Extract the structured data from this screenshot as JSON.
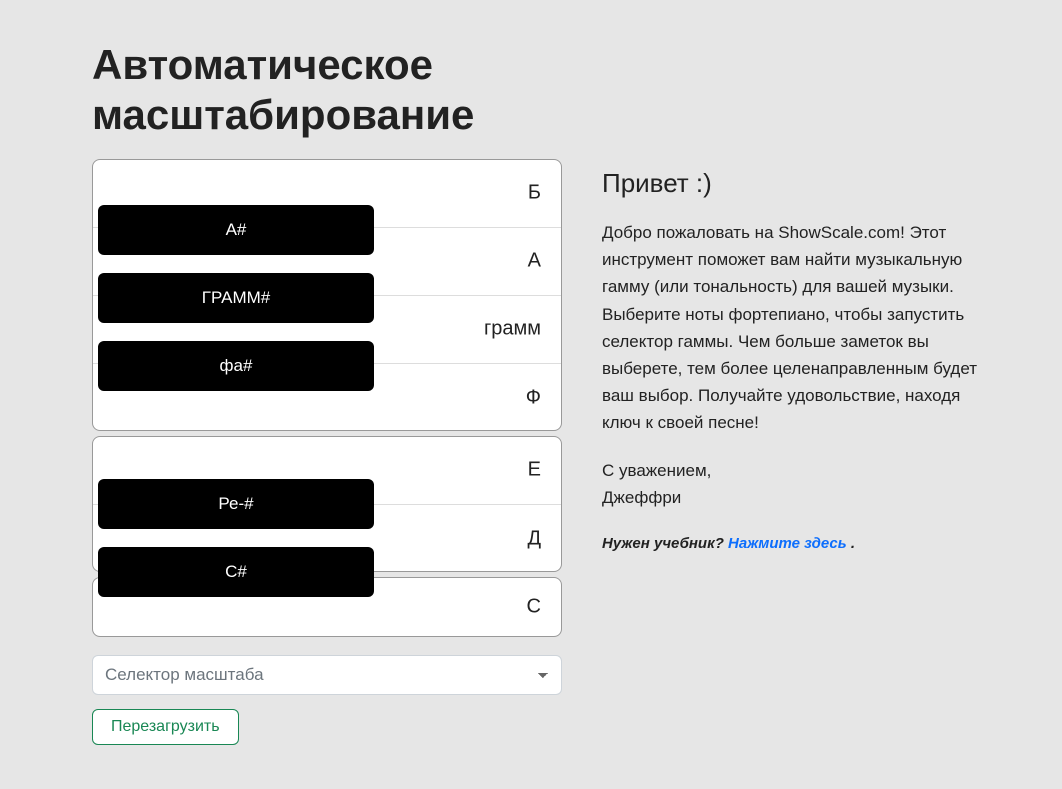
{
  "title": "Автоматическое масштабирование",
  "greeting_heading": "Привет :)",
  "welcome_paragraph": "Добро пожаловать на ShowScale.com! Этот инструмент поможет вам найти музыкальную гамму (или тональность) для вашей музыки. Выберите ноты фортепиано, чтобы запустить селектор гаммы. Чем больше заметок вы выберете, тем более целенаправленным будет ваш выбор. Получайте удовольствие, находя ключ к своей песне!",
  "signoff_regards": "С уважением,",
  "signoff_name": "Джеффри",
  "tutorial_prompt": "Нужен учебник? ",
  "tutorial_link_text": "Нажмите здесь ",
  "tutorial_period": ".",
  "white_keys": [
    "Б",
    "А",
    "грамм",
    "Ф",
    "Е",
    "Д",
    "С"
  ],
  "black_keys": [
    "А#",
    "ГРАММ#",
    "фа#",
    "Ре-#",
    "С#"
  ],
  "selector_placeholder": "Селектор масштаба",
  "reload_label": "Перезагрузить"
}
